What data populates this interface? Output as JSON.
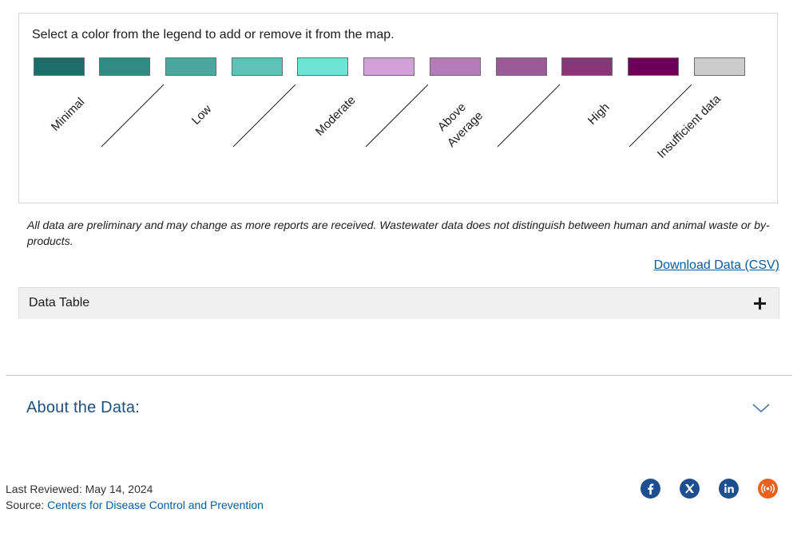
{
  "legend": {
    "instruction": "Select a color from the legend to add or remove it from the map.",
    "swatches": [
      {
        "color": "#1c6e6b"
      },
      {
        "color": "#318a83"
      },
      {
        "color": "#4aa69e"
      },
      {
        "color": "#5fc2b8"
      },
      {
        "color": "#6fe3d6"
      },
      {
        "color": "#d3a0da"
      },
      {
        "color": "#b47db9"
      },
      {
        "color": "#9a5a98"
      },
      {
        "color": "#873677"
      },
      {
        "color": "#6b0058"
      },
      {
        "color": "#cccccc"
      }
    ],
    "labels": {
      "minimal": "Minimal",
      "low": "Low",
      "moderate": "Moderate",
      "above_line1": "Above",
      "above_line2": "Average",
      "high": "High",
      "insufficient": "Insufficient data"
    }
  },
  "note": "All data are preliminary and may change as more reports are received. Wastewater data does not distinguish between human and animal waste or by-products.",
  "download_label": "Download Data (CSV)",
  "data_table": {
    "title": "Data Table"
  },
  "about": {
    "title": "About the Data:"
  },
  "footer": {
    "last_reviewed": "Last Reviewed: May 14, 2024",
    "source_prefix": "Source: ",
    "source_link": "Centers for Disease Control and Prevention"
  },
  "social": [
    {
      "name": "facebook",
      "color": "#1d4f8f"
    },
    {
      "name": "x",
      "color": "#1d4f8f"
    },
    {
      "name": "linkedin",
      "color": "#1d4f8f"
    },
    {
      "name": "syndicate",
      "color": "#e8621c"
    }
  ]
}
